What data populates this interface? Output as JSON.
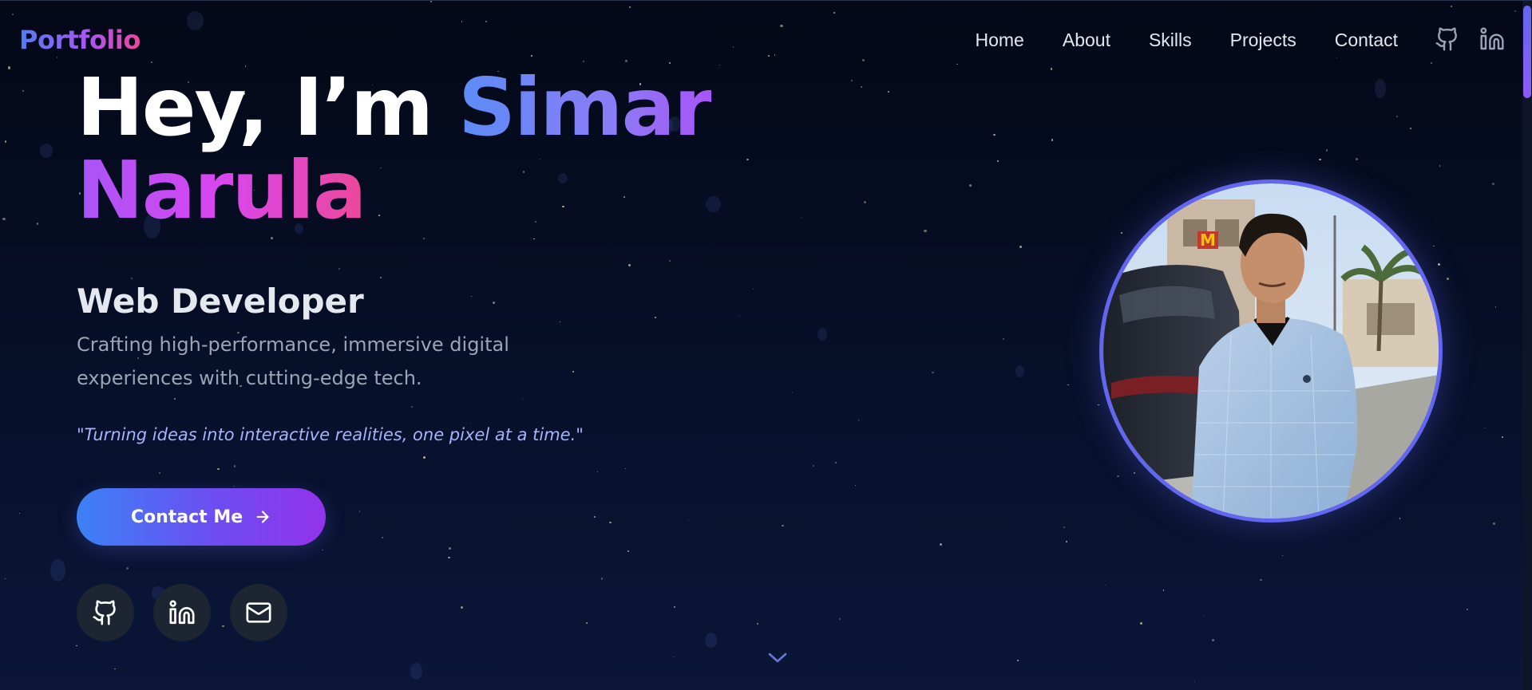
{
  "nav": {
    "logo": "Portfolio",
    "links": [
      "Home",
      "About",
      "Skills",
      "Projects",
      "Contact"
    ],
    "icons": [
      "github-icon",
      "linkedin-icon"
    ]
  },
  "hero": {
    "greeting": "Hey, I’m ",
    "first_name": "Simar",
    "last_name": "Narula",
    "role": "Web Developer",
    "tagline": "Crafting high-performance, immersive digital experiences with cutting-edge tech.",
    "quote": "\"Turning ideas into interactive realities, one pixel at a time.\"",
    "cta_label": "Contact Me",
    "cta_icon": "arrow-right-icon",
    "socials": [
      "github-icon",
      "linkedin-icon",
      "mail-icon"
    ],
    "scroll_icon": "chevron-down-icon"
  },
  "colors": {
    "background": "#050a1c",
    "accent_blue": "#3b82f6",
    "accent_purple": "#9333ea",
    "accent_pink": "#ec4899",
    "portrait_ring": "#6366f1",
    "quote_text": "#a5b4fc"
  }
}
